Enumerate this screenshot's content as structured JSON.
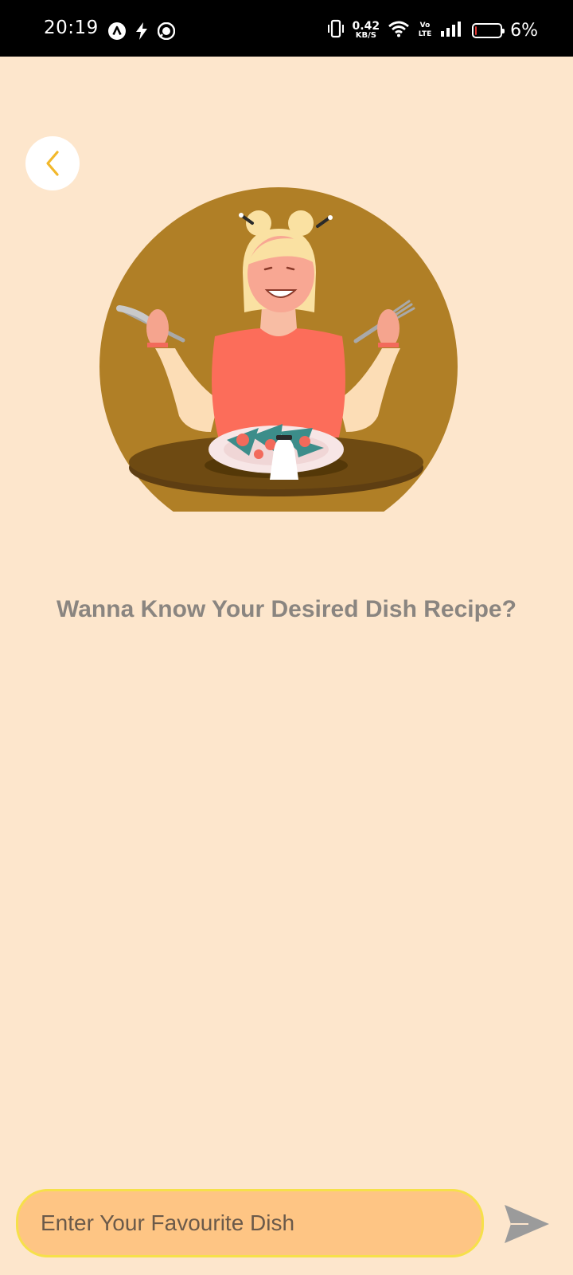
{
  "status_bar": {
    "time": "20:19",
    "net_speed_value": "0.42",
    "net_speed_unit": "KB/S",
    "volte_label": "Vo LTE",
    "battery_percent": "6%",
    "battery_level": 0.06,
    "battery_color": "#E53935",
    "icons": [
      "app-a-icon",
      "flash-icon",
      "messenger-icon",
      "vibrate-icon",
      "wifi-icon",
      "volte-icon",
      "signal-icon",
      "battery-icon"
    ]
  },
  "header": {
    "back_icon": "chevron-left-icon",
    "back_icon_color": "#F2B82B"
  },
  "main": {
    "illustration": "woman-eating-salad-illustration",
    "prompt": "Wanna Know Your Desired Dish Recipe?"
  },
  "input_bar": {
    "placeholder": "Enter Your Favourite Dish",
    "value": "",
    "send_icon": "send-icon"
  },
  "colors": {
    "background": "#FDE6CC",
    "accent_circle": "#B07F26",
    "input_fill": "#FEC584",
    "input_border": "#F6E04A"
  }
}
